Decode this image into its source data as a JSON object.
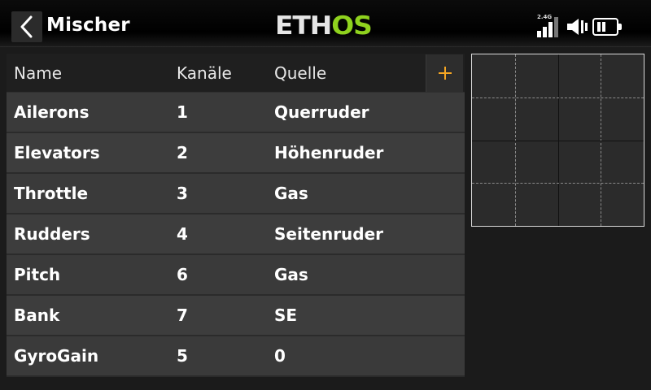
{
  "header": {
    "back_icon": "chevron-left-icon",
    "title": "Mischer",
    "logo_part1": "ETH",
    "logo_part2": "OS",
    "rf_band": "2.4G",
    "icons": [
      "signal-strength-icon",
      "speaker-icon",
      "battery-icon"
    ],
    "colors": {
      "logo_accent": "#8fd21e",
      "add_accent": "#f5a623"
    }
  },
  "table": {
    "columns": [
      "Name",
      "Kanäle",
      "Quelle"
    ],
    "add_label": "+",
    "rows": [
      {
        "name": "Ailerons",
        "channels": "1",
        "source": "Querruder"
      },
      {
        "name": "Elevators",
        "channels": "2",
        "source": "Höhenruder"
      },
      {
        "name": "Throttle",
        "channels": "3",
        "source": "Gas"
      },
      {
        "name": "Rudders",
        "channels": "4",
        "source": "Seitenruder"
      },
      {
        "name": "Pitch",
        "channels": "6",
        "source": "Gas"
      },
      {
        "name": "Bank",
        "channels": "7",
        "source": "SE"
      },
      {
        "name": "GyroGain",
        "channels": "5",
        "source": "0"
      }
    ]
  },
  "graph": {
    "type": "mixer-curve-preview",
    "grid": "4x4"
  }
}
